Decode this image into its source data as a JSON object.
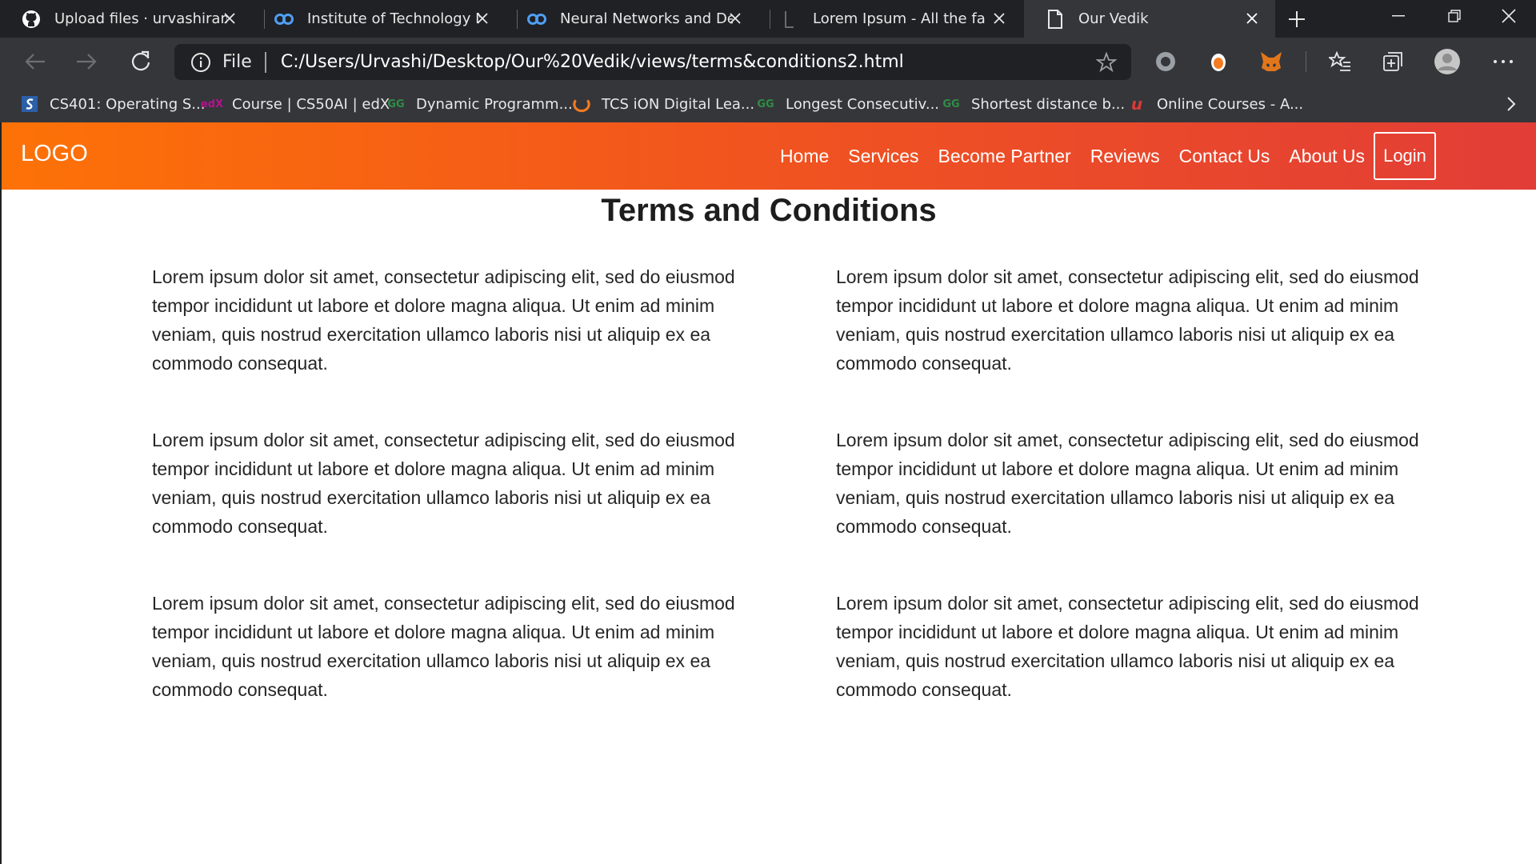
{
  "browser": {
    "tabs": [
      {
        "title": "Upload files · urvashiramdasani",
        "icon": "github-icon"
      },
      {
        "title": "Institute of Technology Nirma",
        "icon": "coursera-icon"
      },
      {
        "title": "Neural Networks and Deep Learning",
        "icon": "coursera-icon"
      },
      {
        "title": "Lorem Ipsum - All the facts",
        "icon": "lipsum-icon"
      },
      {
        "title": "Our Vedik",
        "icon": "document-icon",
        "active": true
      }
    ],
    "address": {
      "scheme": "File",
      "url": "C:/Users/Urvashi/Desktop/Our%20Vedik/views/terms&conditions2.html"
    },
    "bookmarks": [
      {
        "label": "CS401: Operating S...",
        "icon": "saylor-icon"
      },
      {
        "label": "Course | CS50AI | edX",
        "icon": "edx-icon"
      },
      {
        "label": "Dynamic Programm...",
        "icon": "gfg-icon"
      },
      {
        "label": "TCS iON Digital Lea...",
        "icon": "tcs-icon"
      },
      {
        "label": "Longest Consecutiv...",
        "icon": "gfg-icon"
      },
      {
        "label": "Shortest distance b...",
        "icon": "gfg-icon"
      },
      {
        "label": "Online Courses - A...",
        "icon": "udemy-icon"
      }
    ],
    "colors": {
      "frame": "#202124",
      "toolbar": "#35363a"
    }
  },
  "site": {
    "logo": "LOGO",
    "nav": [
      "Home",
      "Services",
      "Become Partner",
      "Reviews",
      "Contact Us",
      "About Us"
    ],
    "login": "Login",
    "colors": {
      "gradient_start": "#fd7207",
      "gradient_end": "#e23d37"
    },
    "title": "Terms and Conditions",
    "paragraphs": [
      "Lorem ipsum dolor sit amet, consectetur adipiscing elit, sed do eiusmod tempor incididunt ut labore et dolore magna aliqua. Ut enim ad minim veniam, quis nostrud exercitation ullamco laboris nisi ut aliquip ex ea commodo consequat.",
      "Lorem ipsum dolor sit amet, consectetur adipiscing elit, sed do eiusmod tempor incididunt ut labore et dolore magna aliqua. Ut enim ad minim veniam, quis nostrud exercitation ullamco laboris nisi ut aliquip ex ea commodo consequat.",
      "Lorem ipsum dolor sit amet, consectetur adipiscing elit, sed do eiusmod tempor incididunt ut labore et dolore magna aliqua. Ut enim ad minim veniam, quis nostrud exercitation ullamco laboris nisi ut aliquip ex ea commodo consequat.",
      "Lorem ipsum dolor sit amet, consectetur adipiscing elit, sed do eiusmod tempor incididunt ut labore et dolore magna aliqua. Ut enim ad minim veniam, quis nostrud exercitation ullamco laboris nisi ut aliquip ex ea commodo consequat.",
      "Lorem ipsum dolor sit amet, consectetur adipiscing elit, sed do eiusmod tempor incididunt ut labore et dolore magna aliqua. Ut enim ad minim veniam, quis nostrud exercitation ullamco laboris nisi ut aliquip ex ea commodo consequat.",
      "Lorem ipsum dolor sit amet, consectetur adipiscing elit, sed do eiusmod tempor incididunt ut labore et dolore magna aliqua. Ut enim ad minim veniam, quis nostrud exercitation ullamco laboris nisi ut aliquip ex ea commodo consequat."
    ]
  }
}
